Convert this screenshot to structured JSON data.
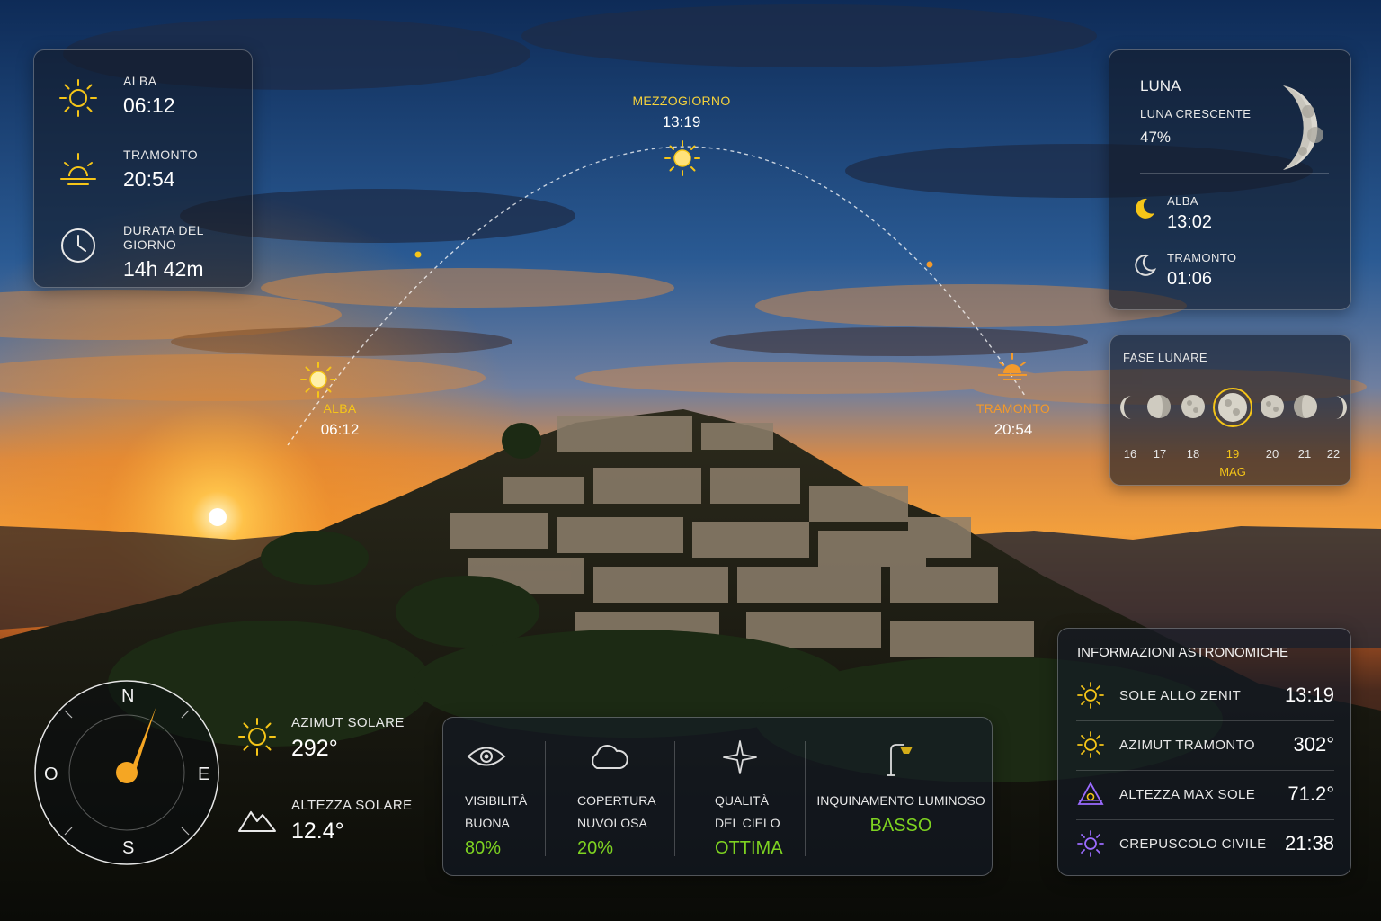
{
  "sun": {
    "sunrise_label": "ALBA",
    "sunrise_time": "06:12",
    "sunset_label": "TRAMONTO",
    "sunset_time": "20:54",
    "daylength_label": "DURATA DEL GIORNO",
    "daylength_value": "14h 42m"
  },
  "arc": {
    "noon_label": "MEZZOGIORNO",
    "noon_time": "13:19",
    "rise_label": "ALBA",
    "rise_time": "06:12",
    "set_label": "TRAMONTO",
    "set_time": "20:54"
  },
  "moon": {
    "title": "LUNA",
    "phase_name": "LUNA CRESCENTE",
    "illumination": "47%",
    "rise_label": "ALBA",
    "rise_time": "13:02",
    "set_label": "TRAMONTO",
    "set_time": "01:06"
  },
  "moon_phase": {
    "title": "FASE LUNARE",
    "days": [
      "16",
      "17",
      "18",
      "19",
      "20",
      "21",
      "22"
    ],
    "selected_month": "MAG"
  },
  "astro": {
    "title": "INFORMAZIONI ASTRONOMICHE",
    "rows": [
      {
        "label": "SOLE ALLO ZENIT",
        "value": "13:19",
        "icon": "sun-icon"
      },
      {
        "label": "AZIMUT TRAMONTO",
        "value": "302°",
        "icon": "sun-icon"
      },
      {
        "label": "ALTEZZA MAX SOLE",
        "value": "71.2°",
        "icon": "triangle-sun-icon"
      },
      {
        "label": "CREPUSCOLO CIVILE",
        "value": "21:38",
        "icon": "twilight-sun-icon"
      }
    ]
  },
  "compass": {
    "north": "N",
    "south": "S",
    "east": "E",
    "west": "O",
    "azimuth_label": "AZIMUT SOLARE",
    "azimuth_value": "292°",
    "altitude_label": "ALTEZZA SOLARE",
    "altitude_value": "12.4°"
  },
  "conditions": {
    "visibility_label_1": "VISIBILITÀ",
    "visibility_label_2": "BUONA",
    "visibility_value": "80%",
    "cloud_label_1": "COPERTURA",
    "cloud_label_2": "NUVOLOSA",
    "cloud_value": "20%",
    "sky_label_1": "QUALITÀ",
    "sky_label_2": "DEL CIELO",
    "sky_value": "OTTIMA",
    "light_label": "INQUINAMENTO LUMINOSO",
    "light_value": "BASSO"
  },
  "colors": {
    "accent_yellow": "#f5c518",
    "accent_orange": "#f39a2b",
    "accent_green": "#7ed321",
    "accent_purple": "#9b6bff"
  }
}
